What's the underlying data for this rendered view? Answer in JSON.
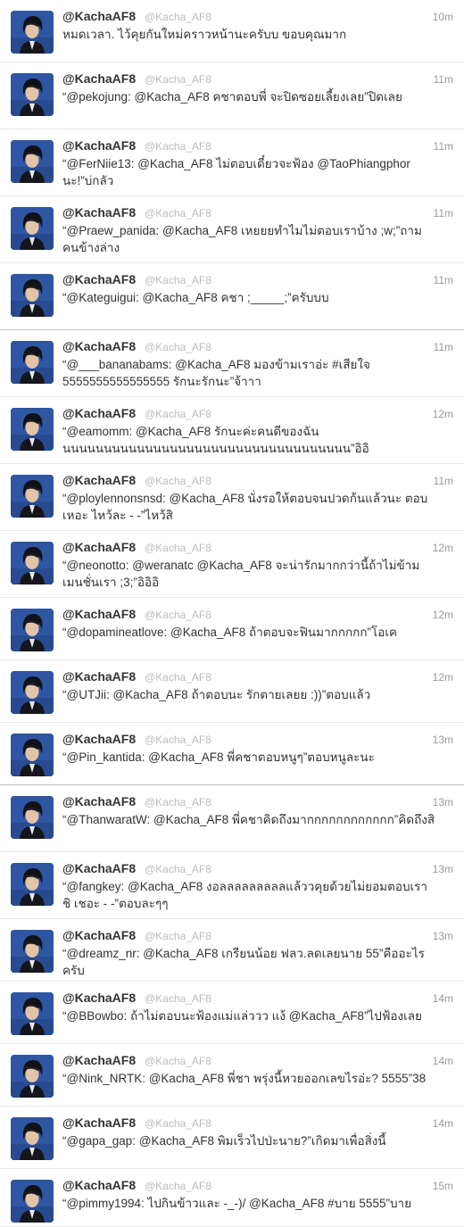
{
  "tweets": [
    {
      "name": "@KachaAF8",
      "handle": "@Kacha_AF8",
      "time": "10m",
      "text": "หมดเวลา. ไว้คุยกันใหม่คราวหน้านะครับบ ขอบคุณมาก"
    },
    {
      "name": "@KachaAF8",
      "handle": "@Kacha_AF8",
      "time": "11m",
      "text": "“@pekojung: @Kacha_AF8 คชาตอบพี่ จะปิดซอยเลี้ยงเลย”ปิดเลย"
    },
    {
      "name": "@KachaAF8",
      "handle": "@Kacha_AF8",
      "time": "11m",
      "text": "“@FerNiie13: @Kacha_AF8 ไม่ตอบเดี๋ยวจะฟ้อง @TaoPhiangphor นะ!”บ่กลัว"
    },
    {
      "name": "@KachaAF8",
      "handle": "@Kacha_AF8",
      "time": "11m",
      "text": "“@Praew_panida: @Kacha_AF8 เหยยยทำไมไม่ตอบเราบ้าง ;w;”ถามคนข้างล่าง"
    },
    {
      "name": "@KachaAF8",
      "handle": "@Kacha_AF8",
      "time": "11m",
      "text": "“@Kateguigui: @Kacha_AF8 คชา ;_____;”ครับบบ"
    },
    {
      "name": "@KachaAF8",
      "handle": "@Kacha_AF8",
      "time": "11m",
      "text": "“@___bananabams: @Kacha_AF8 มองข้ามเราอ่ะ #เสียใจ 5555555555555555 รักนะรักนะ”จ้าาา"
    },
    {
      "name": "@KachaAF8",
      "handle": "@Kacha_AF8",
      "time": "12m",
      "text": "“@eamomm: @Kacha_AF8 รักนะค่ะคนดีของฉัน นนนนนนนนนนนนนนนนนนนนนนนนนนนนนนนนนนน”อิอิ"
    },
    {
      "name": "@KachaAF8",
      "handle": "@Kacha_AF8",
      "time": "11m",
      "text": "“@ploylennonsnsd: @Kacha_AF8 นั่งรอให้ตอบจนปวดก้นแล้วนะ ตอบเหอะ ไหว้ละ - -”ไหว้สิ"
    },
    {
      "name": "@KachaAF8",
      "handle": "@Kacha_AF8",
      "time": "12m",
      "text": "“@neonotto: @weranatc @Kacha_AF8 จะน่ารักมากกว่านี้ถ้าไม่ข้ามเมนชั่นเรา ;3;”อิอิอิ"
    },
    {
      "name": "@KachaAF8",
      "handle": "@Kacha_AF8",
      "time": "12m",
      "text": "“@dopamineatlove: @Kacha_AF8 ถ้าตอบจะฟินมากกกกก”โอเค"
    },
    {
      "name": "@KachaAF8",
      "handle": "@Kacha_AF8",
      "time": "12m",
      "text": "“@UTJii: @Kacha_AF8 ถ้าตอบนะ รักตายเลยย :))”ตอบแล้ว"
    },
    {
      "name": "@KachaAF8",
      "handle": "@Kacha_AF8",
      "time": "13m",
      "text": "“@Pin_kantida: @Kacha_AF8 พี่คชาตอบหนูๆ”ตอบหนูละนะ"
    },
    {
      "name": "@KachaAF8",
      "handle": "@Kacha_AF8",
      "time": "13m",
      "text": "“@ThanwaratW: @Kacha_AF8 พี่คชาคิดถึงมากกกกกกกกกกกก”คิดถึงสิ"
    },
    {
      "name": "@KachaAF8",
      "handle": "@Kacha_AF8",
      "time": "13m",
      "text": "“@fangkey: @Kacha_AF8 งอลลลลลลลลลแล้ววคุยด้วยไม่ยอมตอบเราชิ เชอะ - -”ตอบละๆๆ"
    },
    {
      "name": "@KachaAF8",
      "handle": "@Kacha_AF8",
      "time": "13m",
      "text": "“@dreamz_nr: @Kacha_AF8 เกรียนน้อย ฟลว.ลดเลยนาย 55”คืออะไรครับ"
    },
    {
      "name": "@KachaAF8",
      "handle": "@Kacha_AF8",
      "time": "14m",
      "text": "“@BBowbo: ถ้าไม่ตอบนะฟ้องแม่แล่ววว แง้ @Kacha_AF8”ไปฟ้องเลย"
    },
    {
      "name": "@KachaAF8",
      "handle": "@Kacha_AF8",
      "time": "14m",
      "text": "“@Nink_NRTK: @Kacha_AF8 พี่ชา พรุ่งนี้หวยออกเลขไรอ่ะ? 5555”38"
    },
    {
      "name": "@KachaAF8",
      "handle": "@Kacha_AF8",
      "time": "14m",
      "text": "“@gapa_gap: @Kacha_AF8 พิมเร็วไปป่ะนาย?”เกิดมาเพื่อสิ่งนี้"
    },
    {
      "name": "@KachaAF8",
      "handle": "@Kacha_AF8",
      "time": "15m",
      "text": "“@pimmy1994: ไปกินข้าวและ -_-)/ @Kacha_AF8 #บาย 5555”บาย"
    }
  ]
}
